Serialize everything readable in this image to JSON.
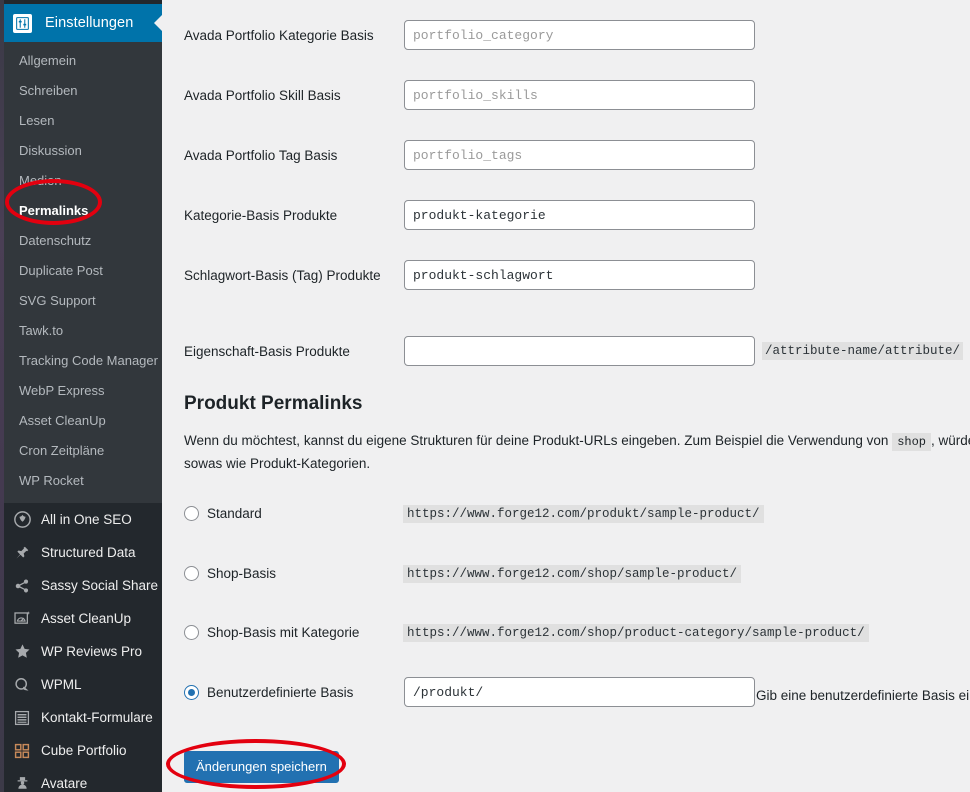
{
  "sidebar": {
    "menu_head": {
      "label": "Einstellungen",
      "icon": "settings-sliders-icon"
    },
    "submenu": [
      {
        "label": "Allgemein",
        "current": false
      },
      {
        "label": "Schreiben",
        "current": false
      },
      {
        "label": "Lesen",
        "current": false
      },
      {
        "label": "Diskussion",
        "current": false
      },
      {
        "label": "Medien",
        "current": false
      },
      {
        "label": "Permalinks",
        "current": true
      },
      {
        "label": "Datenschutz",
        "current": false
      },
      {
        "label": "Duplicate Post",
        "current": false
      },
      {
        "label": "SVG Support",
        "current": false
      },
      {
        "label": "Tawk.to",
        "current": false
      },
      {
        "label": "Tracking Code Manager",
        "current": false
      },
      {
        "label": "WebP Express",
        "current": false
      },
      {
        "label": "Asset CleanUp",
        "current": false
      },
      {
        "label": "Cron Zeitpläne",
        "current": false
      },
      {
        "label": "WP Rocket",
        "current": false
      }
    ],
    "plugins": [
      {
        "label": "All in One SEO",
        "icon": "aioseo-gear-icon"
      },
      {
        "label": "Structured Data",
        "icon": "pin-icon"
      },
      {
        "label": "Sassy Social Share",
        "icon": "share-icon"
      },
      {
        "label": "Asset CleanUp",
        "icon": "speedometer-icon"
      },
      {
        "label": "WP Reviews Pro",
        "icon": "star-icon"
      },
      {
        "label": "WPML",
        "icon": "globe-q-icon"
      },
      {
        "label": "Kontakt-Formulare",
        "icon": "list-form-icon"
      },
      {
        "label": "Cube Portfolio",
        "icon": "grid-icon"
      },
      {
        "label": "Avatare",
        "icon": "avatar-icon"
      }
    ]
  },
  "form_fields": [
    {
      "label": "Avada Portfolio Kategorie Basis",
      "value": "",
      "placeholder": "portfolio_category",
      "suffix": ""
    },
    {
      "label": "Avada Portfolio Skill Basis",
      "value": "",
      "placeholder": "portfolio_skills",
      "suffix": ""
    },
    {
      "label": "Avada Portfolio Tag Basis",
      "value": "",
      "placeholder": "portfolio_tags",
      "suffix": ""
    },
    {
      "label": "Kategorie-Basis Produkte",
      "value": "produkt-kategorie",
      "placeholder": "",
      "suffix": ""
    },
    {
      "label": "Schlagwort-Basis (Tag) Produkte",
      "value": "produkt-schlagwort",
      "placeholder": "",
      "suffix": ""
    },
    {
      "label": "Eigenschaft-Basis Produkte",
      "value": "",
      "placeholder": "",
      "suffix": "/attribute-name/attribute/"
    }
  ],
  "section": {
    "title": "Produkt Permalinks",
    "desc_part1": "Wenn du möchtest, kannst du eigene Strukturen für deine Produkt-URLs eingeben. Zum Beispiel die Verwendung von",
    "desc_code": "shop",
    "desc_part2": ", würde deine Produkt-URLs, nicht sowas wie Produkt-Kategorien."
  },
  "permalink_options": [
    {
      "label": "Standard",
      "url": "https://www.forge12.com/produkt/sample-product/",
      "selected": false,
      "has_input": false
    },
    {
      "label": "Shop-Basis",
      "url": "https://www.forge12.com/shop/sample-product/",
      "selected": false,
      "has_input": false
    },
    {
      "label": "Shop-Basis mit Kategorie",
      "url": "https://www.forge12.com/shop/product-category/sample-product/",
      "selected": false,
      "has_input": false
    },
    {
      "label": "Benutzerdefinierte Basis",
      "url": "",
      "selected": true,
      "has_input": true,
      "input_value": "/produkt/",
      "hint": "Gib eine benutzerdefinierte Basis ein"
    }
  ],
  "save_button": {
    "label": "Änderungen speichern"
  },
  "colors": {
    "accent_blue": "#0073aa",
    "button_blue": "#2271b1",
    "sidebar_dark": "#32373c",
    "sidebar_darker": "#23282d",
    "annotation_red": "#e3000f",
    "content_bg": "#f0f0f1"
  }
}
